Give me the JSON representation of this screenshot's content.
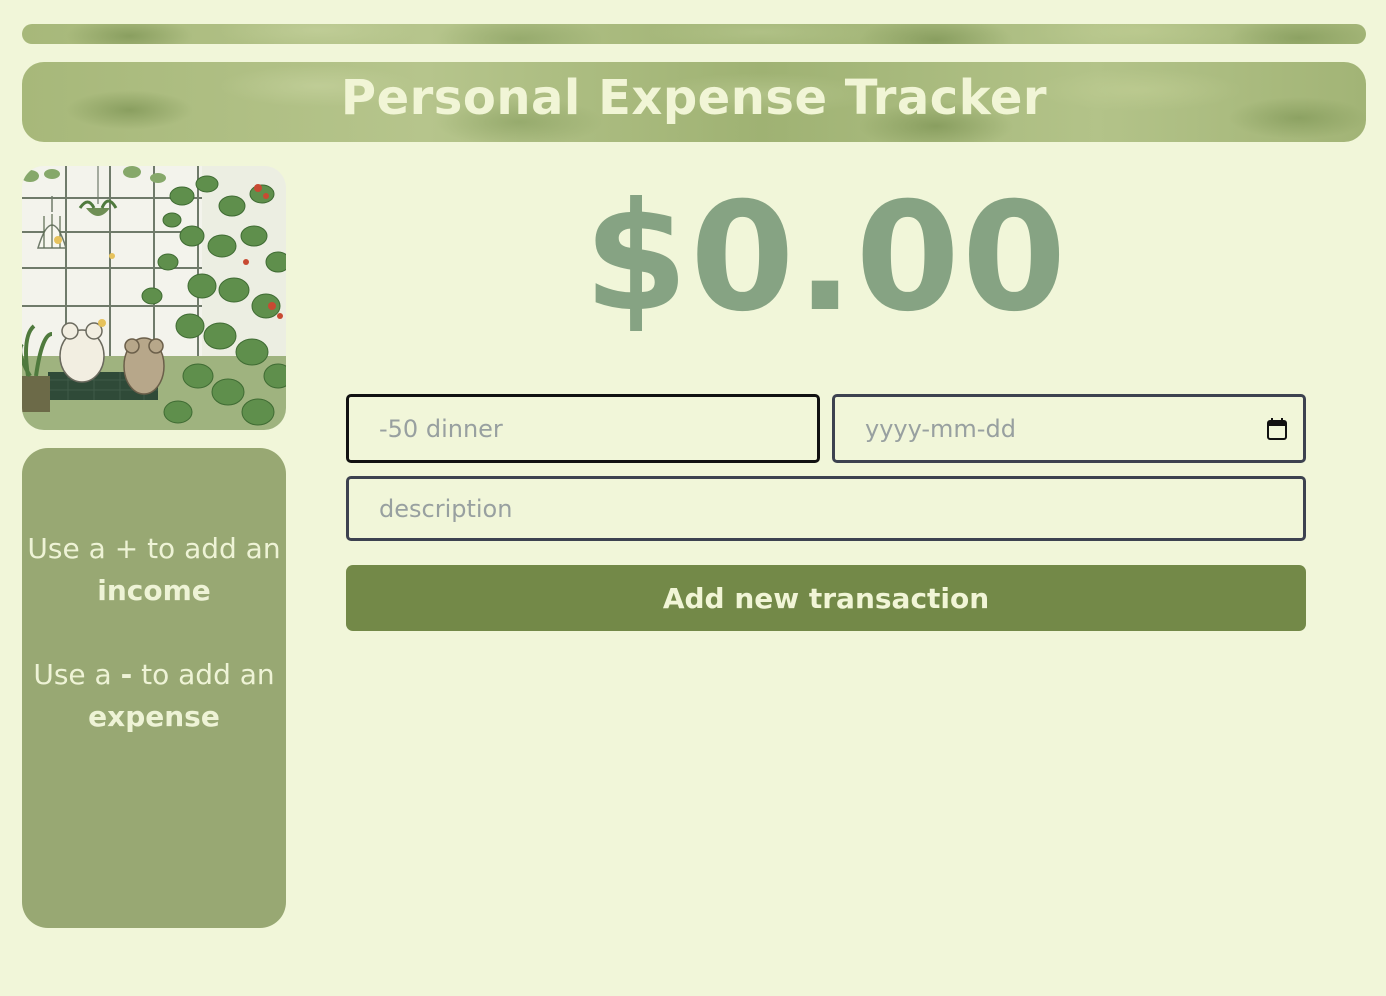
{
  "header": {
    "title": "Personal Expense Tracker"
  },
  "sidebar": {
    "illustration_name": "greenhouse-window-illustration",
    "income_hint": {
      "prefix": "Use a",
      "symbol": "+",
      "mid": "to add an",
      "keyword": "income"
    },
    "expense_hint": {
      "prefix": "Use a",
      "symbol": "-",
      "mid": "to add an",
      "keyword": "expense"
    }
  },
  "main": {
    "balance": "$0.00",
    "amount_placeholder": "-50 dinner",
    "date_placeholder": "yyyy-mm-dd",
    "description_placeholder": "description",
    "add_button_label": "Add new transaction"
  },
  "colors": {
    "background": "#f1f6d9",
    "balance_text": "#86a383",
    "button": "#738948",
    "panel": "#98a873",
    "header_banner": "#a9b97d"
  },
  "icons": {
    "date_picker": "calendar-icon"
  }
}
